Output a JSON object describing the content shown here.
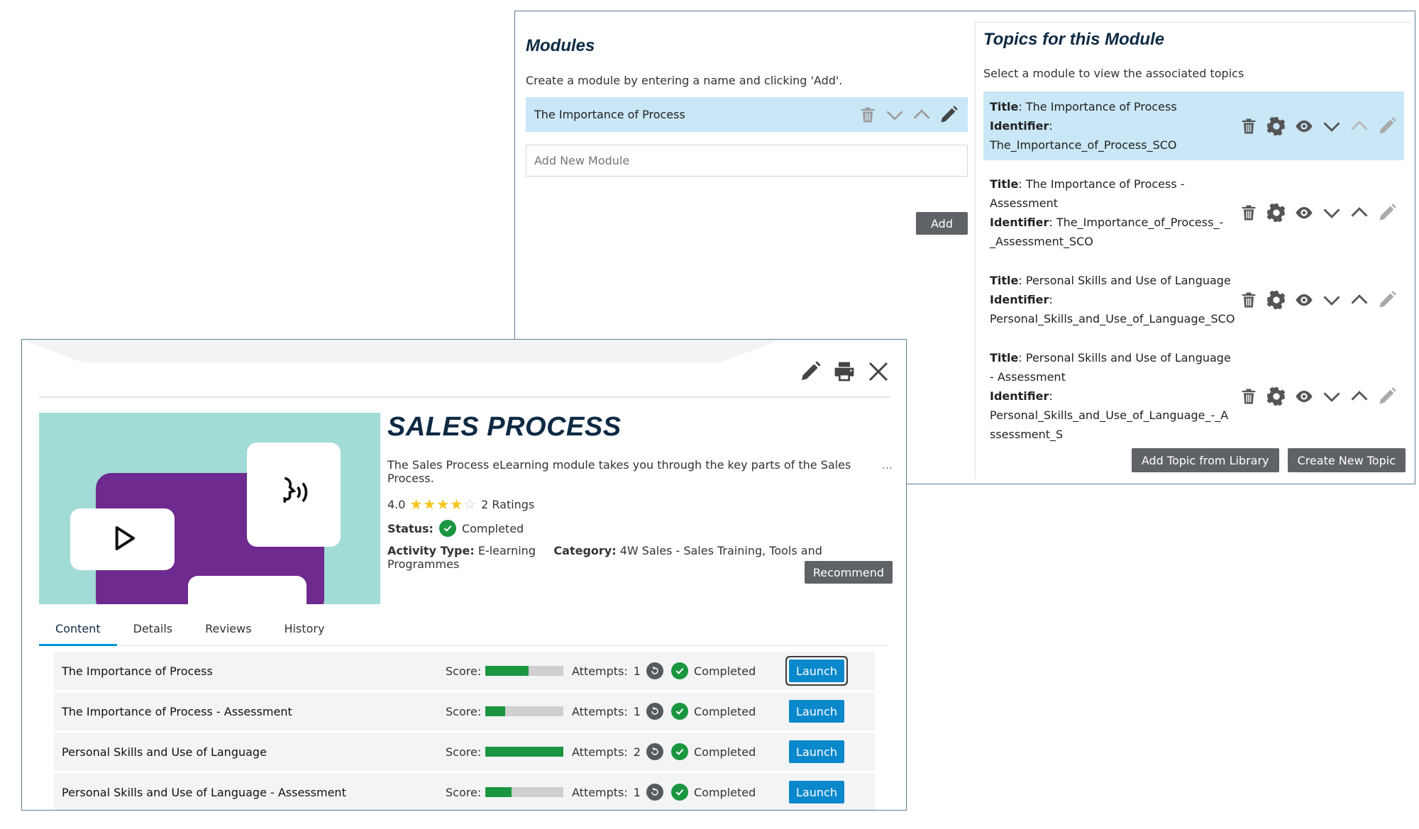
{
  "modules": {
    "heading": "Modules",
    "help": "Create a module by entering a name and clicking 'Add'.",
    "items": [
      {
        "label": "The Importance of Process"
      }
    ],
    "new_placeholder": "Add New Module",
    "add_label": "Add"
  },
  "topics": {
    "heading": "Topics for this Module",
    "help": "Select a module to view the associated topics",
    "title_key": "Title",
    "identifier_key": "Identifier",
    "items": [
      {
        "title": "The Importance of Process",
        "identifier": "The_Importance_of_Process_SCO"
      },
      {
        "title": "The Importance of Process - Assessment",
        "identifier": "The_Importance_of_Process_-_Assessment_SCO"
      },
      {
        "title": "Personal Skills and Use of Language",
        "identifier": "Personal_Skills_and_Use_of_Language_SCO"
      },
      {
        "title": "Personal Skills and Use of Language - Assessment",
        "identifier": "Personal_Skills_and_Use_of_Language_-_Assessment_S"
      }
    ],
    "add_from_library_label": "Add Topic from Library",
    "create_new_label": "Create New Topic"
  },
  "course": {
    "title": "SALES PROCESS",
    "description": "The Sales Process eLearning module takes you through the key parts of the Sales Process.",
    "more": "...",
    "rating_value": "4.0",
    "rating_stars": 4,
    "ratings_count": "2 Ratings",
    "status_label": "Status:",
    "status_value": "Completed",
    "activity_type_label": "Activity Type:",
    "activity_type_value": "E-learning",
    "category_label": "Category:",
    "category_value": "4W Sales - Sales Training, Tools and Programmes",
    "recommend_label": "Recommend"
  },
  "tabs": [
    {
      "label": "Content",
      "active": true
    },
    {
      "label": "Details",
      "active": false
    },
    {
      "label": "Reviews",
      "active": false
    },
    {
      "label": "History",
      "active": false
    }
  ],
  "content": {
    "score_label": "Score:",
    "attempts_label": "Attempts:",
    "launch_label": "Launch",
    "rows": [
      {
        "name": "The Importance of Process",
        "score_fraction": 0.55,
        "attempts": "1",
        "status": "Completed"
      },
      {
        "name": "The Importance of Process - Assessment",
        "score_fraction": 0.25,
        "attempts": "1",
        "status": "Completed"
      },
      {
        "name": "Personal Skills and Use of Language",
        "score_fraction": 1.0,
        "attempts": "2",
        "status": "Completed"
      },
      {
        "name": "Personal Skills and Use of Language - Assessment",
        "score_fraction": 0.33,
        "attempts": "1",
        "status": "Completed"
      }
    ]
  },
  "colors": {
    "heading": "#0e2a44",
    "selected_row": "#c9e7f6",
    "accent_blue": "#0a88cc",
    "success_green": "#1a9640",
    "thumbnail_bg": "#a2dcd6",
    "thumbnail_purple": "#6e2a8e"
  },
  "icons": [
    "trash-icon",
    "chevron-down-icon",
    "chevron-up-icon",
    "pencil-icon",
    "gear-icon",
    "eye-icon",
    "print-icon",
    "close-icon",
    "check-circle-icon",
    "reset-icon",
    "play-icon",
    "speaking-head-icon"
  ]
}
